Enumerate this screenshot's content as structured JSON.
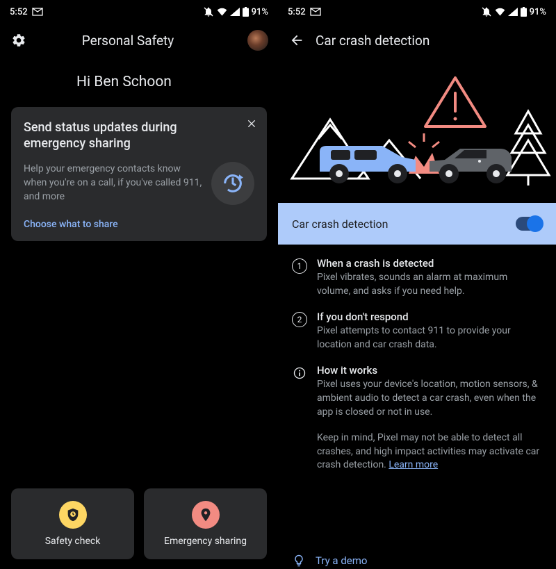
{
  "status": {
    "time": "5:52",
    "battery_pct": "91%"
  },
  "left": {
    "app_title": "Personal Safety",
    "greeting": "Hi Ben Schoon",
    "card": {
      "title": "Send status updates during emergency sharing",
      "desc": "Help your emergency contacts know when you're on a call, if you've called 911, and more",
      "link": "Choose what to share"
    },
    "tiles": {
      "safety_check": "Safety check",
      "emergency_sharing": "Emergency sharing"
    }
  },
  "right": {
    "app_title": "Car crash detection",
    "toggle_label": "Car crash detection",
    "toggle_on": true,
    "steps": [
      {
        "num": "1",
        "title": "When a crash is detected",
        "desc": "Pixel vibrates, sounds an alarm at maximum volume, and asks if you need help."
      },
      {
        "num": "2",
        "title": "If you don't respond",
        "desc": "Pixel attempts to contact 911 to provide your location and car crash data."
      }
    ],
    "how_it_works": {
      "title": "How it works",
      "desc": "Pixel uses your device's location, motion sensors, & ambient audio to detect a car crash, even when the app is closed or not in use."
    },
    "note": "Keep in mind, Pixel may not be able to detect all crashes, and high impact activities may activate car crash detection. ",
    "learn_more": "Learn more",
    "demo": "Try a demo"
  }
}
